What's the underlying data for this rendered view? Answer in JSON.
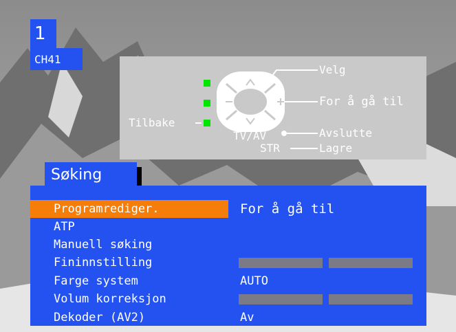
{
  "channel": {
    "number": "1",
    "name": "CH41"
  },
  "guide": {
    "select": "Velg",
    "go_to": "For å gå til",
    "back": "Tilbake",
    "tv_av": "TV/AV",
    "exit": "Avslutte",
    "str": "STR",
    "store": "Lagre"
  },
  "menu": {
    "title": "Søking",
    "items": [
      {
        "label": "Programrediger.",
        "value": "For å gå til",
        "selected": true
      },
      {
        "label": "ATP",
        "value": ""
      },
      {
        "label": "Manuell søking",
        "value": ""
      },
      {
        "label": "Fininnstilling",
        "value": ""
      },
      {
        "label": "Farge system",
        "value": "AUTO"
      },
      {
        "label": "Volum korreksjon",
        "value": ""
      },
      {
        "label": "Dekoder (AV2)",
        "value": "Av"
      }
    ]
  },
  "colors": {
    "menu_blue": "#2352f0",
    "highlight_orange": "#f57d0a",
    "indicator_green": "#00e600",
    "panel_gray": "#c9c9c9",
    "bar_gray": "#7b7b88"
  }
}
